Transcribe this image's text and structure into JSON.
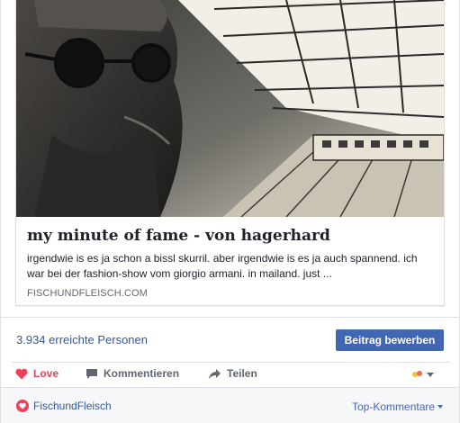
{
  "link_preview": {
    "title": "my minute of fame - von hagerhard",
    "description": "irgendwie is es ja schon a bissl skurril. aber irgendwie is es ja auch spannend. ich war bei der fashion-show vom giorgio armani. in mailand. just ...",
    "domain": "FISCHUNDFLEISCH.COM",
    "image_icon": "photo-stylized-portrait-train-station"
  },
  "insights": {
    "reach_text": "3.934 erreichte Personen",
    "boost_label": "Beitrag bewerben"
  },
  "actions": {
    "love_label": "Love",
    "comment_label": "Kommentieren",
    "share_label": "Teilen"
  },
  "comments": {
    "page_name": "FischundFleisch",
    "sort_label": "Top-Kommentare"
  },
  "colors": {
    "link_blue": "#365899",
    "button_blue": "#4267b2",
    "love_red": "#f33e58",
    "muted_gray": "#606770"
  }
}
